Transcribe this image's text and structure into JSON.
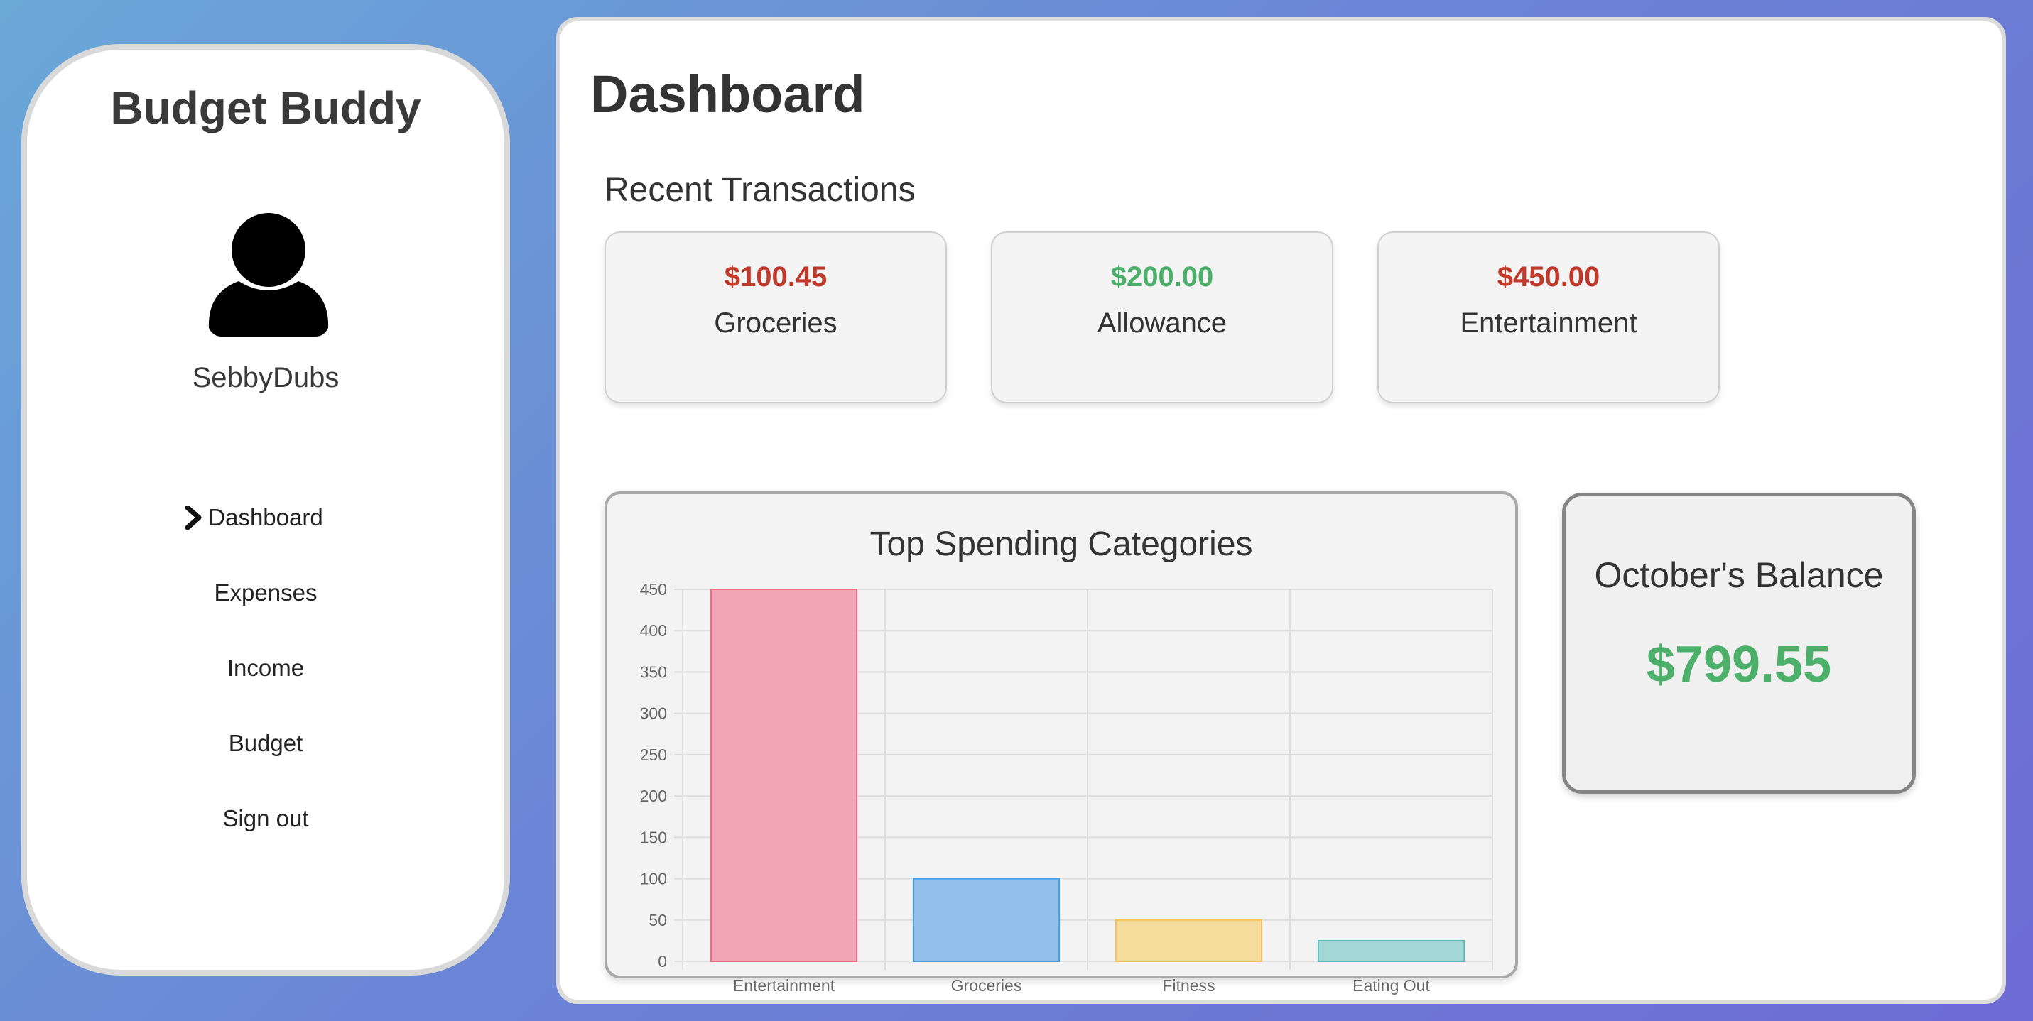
{
  "app": {
    "title": "Budget Buddy"
  },
  "user": {
    "name": "SebbyDubs",
    "avatar_icon": "user-icon"
  },
  "nav": {
    "active": "Dashboard",
    "items": [
      {
        "label": "Dashboard",
        "active": true
      },
      {
        "label": "Expenses",
        "active": false
      },
      {
        "label": "Income",
        "active": false
      },
      {
        "label": "Budget",
        "active": false
      },
      {
        "label": "Sign out",
        "active": false
      }
    ]
  },
  "page": {
    "title": "Dashboard"
  },
  "transactions": {
    "title": "Recent Transactions",
    "items": [
      {
        "amount": "$100.45",
        "label": "Groceries",
        "color": "#c0392b"
      },
      {
        "amount": "$200.00",
        "label": "Allowance",
        "color": "#4caf6a"
      },
      {
        "amount": "$450.00",
        "label": "Entertainment",
        "color": "#c0392b"
      }
    ]
  },
  "balance": {
    "title": "October's Balance",
    "amount": "$799.55",
    "color": "#4caf6a"
  },
  "chart_data": {
    "type": "bar",
    "title": "Top Spending Categories",
    "categories": [
      "Entertainment",
      "Groceries",
      "Fitness",
      "Eating Out"
    ],
    "values": [
      450,
      100,
      50,
      25
    ],
    "colors": [
      "#f0a6b5",
      "#93c0ea",
      "#f6dc9c",
      "#a3d7d5"
    ],
    "border_colors": [
      "#ee6b86",
      "#4a9de3",
      "#f2c25b",
      "#5ec0bd"
    ],
    "ylim": [
      0,
      450
    ],
    "yticks": [
      "0",
      "50",
      "100",
      "150",
      "200",
      "250",
      "300",
      "350",
      "400",
      "450"
    ],
    "grid": true
  }
}
